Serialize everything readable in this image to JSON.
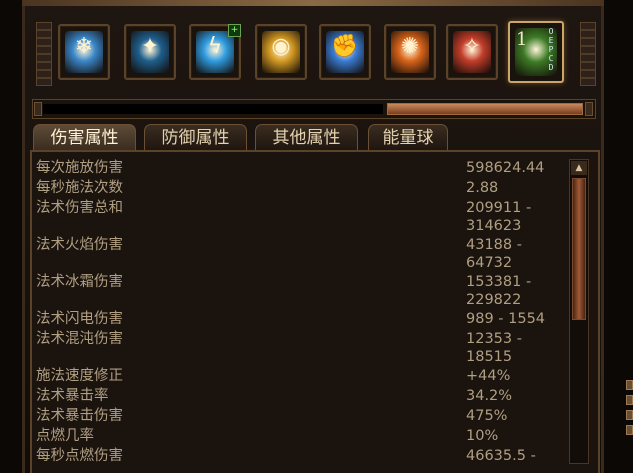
{
  "skills": [
    {
      "name": "frost-rune-icon",
      "color": "#3a86c8",
      "glyph": "❄"
    },
    {
      "name": "ice-shards-icon",
      "color": "#1f5f8d",
      "glyph": "✦"
    },
    {
      "name": "lightning-figure-icon",
      "color": "#2f9be0",
      "glyph": "ϟ",
      "badge": "+"
    },
    {
      "name": "golden-eye-icon",
      "color": "#d49a24",
      "glyph": "◉"
    },
    {
      "name": "fist-icon",
      "color": "#3a7bd1",
      "glyph": "✊"
    },
    {
      "name": "fire-ring-icon",
      "color": "#d8641a",
      "glyph": "✺"
    },
    {
      "name": "arcane-figure-icon",
      "color": "#c23d2a",
      "glyph": "✧"
    },
    {
      "name": "poison-tree-icon",
      "color": "#3c7a26",
      "glyph": "♣"
    }
  ],
  "hotkey": {
    "number": "1",
    "letters": [
      "O",
      "E",
      "P",
      "C",
      "D"
    ]
  },
  "tabs": [
    {
      "label": "伤害属性",
      "active": true
    },
    {
      "label": "防御属性",
      "active": false
    },
    {
      "label": "其他属性",
      "active": false
    },
    {
      "label": "能量球",
      "active": false
    }
  ],
  "stats": [
    {
      "label": "每次施放伤害",
      "value": [
        "598624.44"
      ]
    },
    {
      "label": "每秒施法次数",
      "value": [
        "2.88"
      ]
    },
    {
      "label": "法术伤害总和",
      "value": [
        "209911 -",
        "314623"
      ]
    },
    {
      "label": "法术火焰伤害",
      "value": [
        "43188 -",
        "64732"
      ]
    },
    {
      "label": "法术冰霜伤害",
      "value": [
        "153381 -",
        "229822"
      ]
    },
    {
      "label": "法术闪电伤害",
      "value": [
        "989 - 1554"
      ]
    },
    {
      "label": "法术混沌伤害",
      "value": [
        "12353 -",
        "18515"
      ]
    },
    {
      "label": "施法速度修正",
      "value": [
        "+44%"
      ]
    },
    {
      "label": "法术暴击率",
      "value": [
        "34.2%"
      ]
    },
    {
      "label": "法术暴击伤害",
      "value": [
        "475%"
      ]
    },
    {
      "label": "点燃几率",
      "value": [
        "10%"
      ]
    },
    {
      "label": "每秒点燃伤害",
      "value": [
        "46635.5 -"
      ]
    }
  ]
}
